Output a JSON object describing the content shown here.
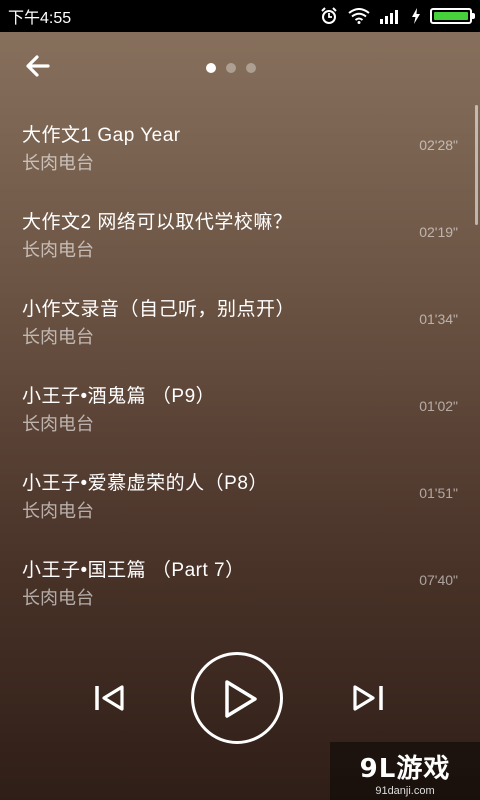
{
  "statusbar": {
    "time": "下午4:55"
  },
  "nav": {
    "page_count": 3,
    "active_page": 0
  },
  "tracks": [
    {
      "title": "大作文1 Gap Year",
      "artist": "长肉电台",
      "duration": "02'28\""
    },
    {
      "title": "大作文2 网络可以取代学校嘛？",
      "artist": "长肉电台",
      "duration": "02'19\""
    },
    {
      "title": "小作文录音（自己听，别点开）",
      "artist": "长肉电台",
      "duration": "01'34\""
    },
    {
      "title": "小王子•酒鬼篇 （P9）",
      "artist": "长肉电台",
      "duration": "01'02\""
    },
    {
      "title": "小王子•爱慕虚荣的人（P8）",
      "artist": "长肉电台",
      "duration": "01'51\""
    },
    {
      "title": "小王子•国王篇 （Part 7）",
      "artist": "长肉电台",
      "duration": "07'40\""
    }
  ],
  "watermark": {
    "brand": "9L游戏",
    "url": "91danji.com"
  },
  "colors": {
    "battery": "#46d13a"
  }
}
